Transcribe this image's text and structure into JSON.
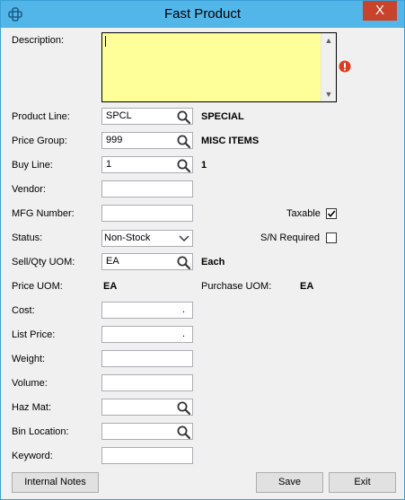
{
  "window": {
    "title": "Fast Product",
    "close_label": "X"
  },
  "labels": {
    "description": "Description:",
    "product_line": "Product Line:",
    "price_group": "Price Group:",
    "buy_line": "Buy Line:",
    "vendor": "Vendor:",
    "mfg_number": "MFG Number:",
    "status": "Status:",
    "sell_qty_uom": "Sell/Qty UOM:",
    "price_uom": "Price UOM:",
    "cost": "Cost:",
    "list_price": "List Price:",
    "weight": "Weight:",
    "volume": "Volume:",
    "haz_mat": "Haz Mat:",
    "bin_location": "Bin Location:",
    "keyword": "Keyword:",
    "taxable": "Taxable",
    "sn_required": "S/N Required",
    "purchase_uom": "Purchase UOM:"
  },
  "fields": {
    "description": "",
    "product_line": "SPCL",
    "product_line_desc": "SPECIAL",
    "price_group": "999",
    "price_group_desc": "MISC ITEMS",
    "buy_line": "1",
    "buy_line_desc": "1",
    "vendor": "",
    "mfg_number": "",
    "status": "Non-Stock",
    "sell_qty_uom": "EA",
    "sell_qty_uom_desc": "Each",
    "price_uom": "EA",
    "purchase_uom": "EA",
    "cost_decimal": ".",
    "list_price_decimal": ".",
    "weight": "",
    "volume": "",
    "haz_mat": "",
    "bin_location": "",
    "keyword": ""
  },
  "checkboxes": {
    "taxable": true,
    "sn_required": false
  },
  "buttons": {
    "internal_notes": "Internal Notes",
    "save": "Save",
    "exit": "Exit"
  },
  "colors": {
    "title_bar": "#52b6e8",
    "close": "#c7432c",
    "description_bg": "#ffff99",
    "warning": "#e23a1f"
  }
}
